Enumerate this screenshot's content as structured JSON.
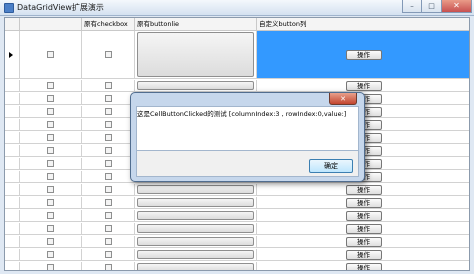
{
  "window": {
    "title": "DataGridView扩展演示",
    "buttons": {
      "minimize": "–",
      "maximize": "□",
      "close": "✕"
    }
  },
  "grid": {
    "columns": [
      "",
      "原有checkbox",
      "原有buttonlie",
      "自定义button列"
    ],
    "row_button_label": "操作",
    "row_count": 17
  },
  "dialog": {
    "close": "✕",
    "message": "这是CellButtonClicked的测试 [columnIndex:3 , rowIndex:0,value:]",
    "ok": "确定"
  },
  "colors": {
    "selection": "#3399ff",
    "titlebar": "#d4e1f0"
  }
}
